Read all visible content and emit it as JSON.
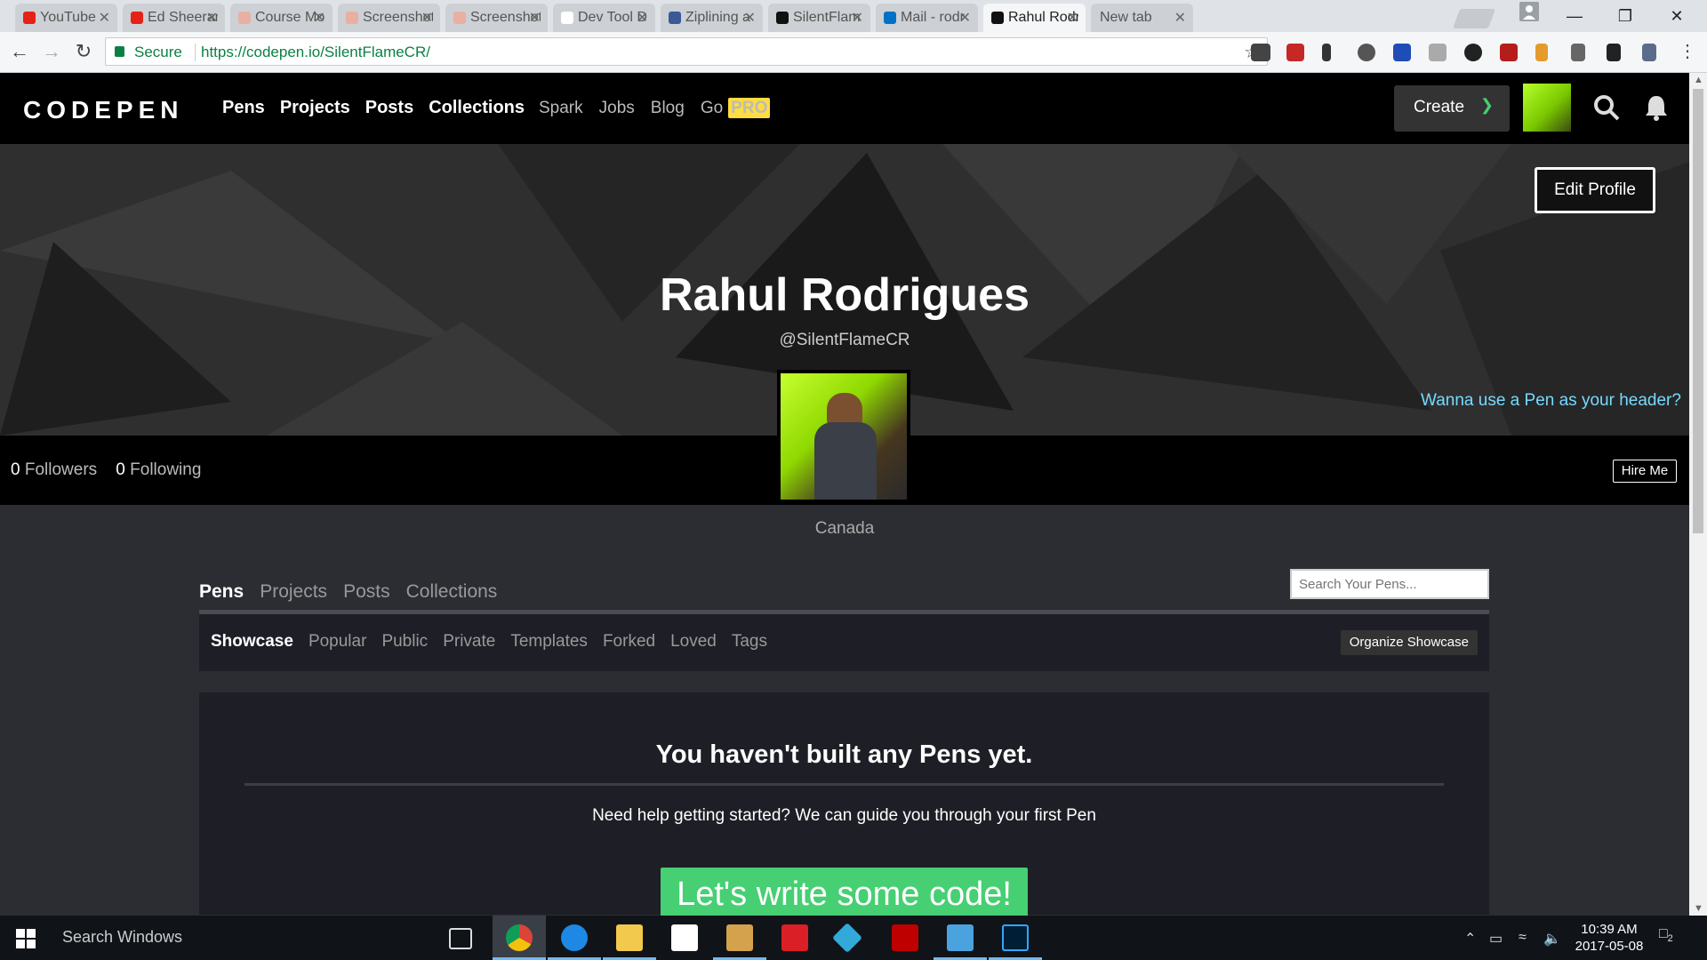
{
  "browser": {
    "tabs": [
      {
        "label": "YouTube",
        "icon": "youtube-icon",
        "color": "#e62117"
      },
      {
        "label": "Ed Sheeran",
        "icon": "youtube-icon",
        "color": "#e62117"
      },
      {
        "label": "Course Mo",
        "icon": "codepen-dot-icon",
        "color": "#e8b0a3"
      },
      {
        "label": "Screenshot",
        "icon": "codepen-dot-icon",
        "color": "#e8b0a3"
      },
      {
        "label": "Screenshot",
        "icon": "codepen-dot-icon",
        "color": "#e8b0a3"
      },
      {
        "label": "Dev Tool D",
        "icon": "page-icon",
        "color": "#ffffff"
      },
      {
        "label": "Ziplining a",
        "icon": "facebook-icon",
        "color": "#3b5998"
      },
      {
        "label": "SilentFlam",
        "icon": "github-icon",
        "color": "#111111"
      },
      {
        "label": "Mail - rodr",
        "icon": "outlook-icon",
        "color": "#0072c6"
      },
      {
        "label": "Rahul Rodr",
        "icon": "codepen-icon",
        "color": "#111111"
      },
      {
        "label": "New tab",
        "icon": "none",
        "color": "#cdd0d4"
      }
    ],
    "active_tab_index": 9,
    "secure_label": "Secure",
    "url": "https://codepen.io/SilentFlameCR/"
  },
  "codepen": {
    "logo": "CODEPEN",
    "nav_main": [
      "Pens",
      "Projects",
      "Posts",
      "Collections"
    ],
    "nav_sub": [
      "Spark",
      "Jobs",
      "Blog",
      "Go"
    ],
    "pro_badge": "PRO",
    "create_label": "Create",
    "accent": "#47cf73"
  },
  "profile": {
    "edit_profile": "Edit Profile",
    "name": "Rahul Rodrigues",
    "handle": "@SilentFlameCR",
    "header_link": "Wanna use a Pen as your header?",
    "followers_count": "0",
    "followers_label": "Followers",
    "following_count": "0",
    "following_label": "Following",
    "hire_me": "Hire Me",
    "location": "Canada"
  },
  "content": {
    "tabs": [
      "Pens",
      "Projects",
      "Posts",
      "Collections"
    ],
    "search_placeholder": "Search Your Pens...",
    "filters": [
      "Showcase",
      "Popular",
      "Public",
      "Private",
      "Templates",
      "Forked",
      "Loved",
      "Tags"
    ],
    "organize_label": "Organize Showcase",
    "empty_title": "You haven't built any Pens yet.",
    "empty_text": "Need help getting started? We can guide you through your first Pen",
    "cta_label": "Let's write some code!"
  },
  "taskbar": {
    "search_label": "Search Windows",
    "time": "10:39 AM",
    "date": "2017-05-08",
    "notification_count": "2"
  }
}
